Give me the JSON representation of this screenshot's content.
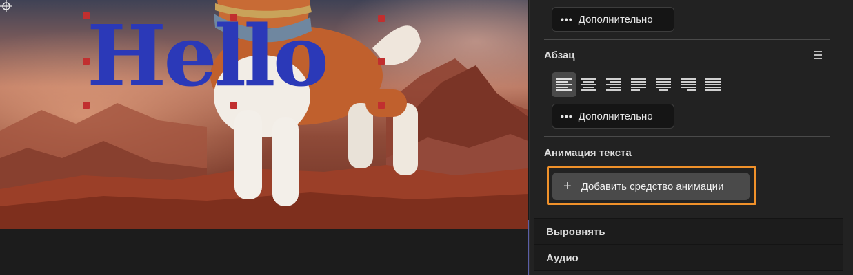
{
  "canvas": {
    "title_text": "Hello",
    "text_color": "#2b39b8",
    "handle_color": "#c12f2f"
  },
  "panel": {
    "more_button_top": {
      "icon": "ellipsis-icon",
      "label": "Дополнительно"
    },
    "paragraph": {
      "title": "Абзац",
      "menu_icon": "hamburger-menu-icon",
      "align_buttons": [
        {
          "icon": "align-left-icon",
          "active": true
        },
        {
          "icon": "align-center-icon",
          "active": false
        },
        {
          "icon": "align-right-icon",
          "active": false
        },
        {
          "icon": "justify-last-left-icon",
          "active": false
        },
        {
          "icon": "justify-last-center-icon",
          "active": false
        },
        {
          "icon": "justify-last-right-icon",
          "active": false
        },
        {
          "icon": "justify-all-icon",
          "active": false
        }
      ],
      "more_button": {
        "icon": "ellipsis-icon",
        "label": "Дополнительно"
      }
    },
    "text_animation": {
      "title": "Анимация текста",
      "add_button": {
        "icon": "plus-icon",
        "label": "Добавить средство анимации"
      },
      "highlight_color": "#f0912a"
    },
    "collapsed_sections": [
      "Выровнять",
      "Аудио"
    ]
  }
}
